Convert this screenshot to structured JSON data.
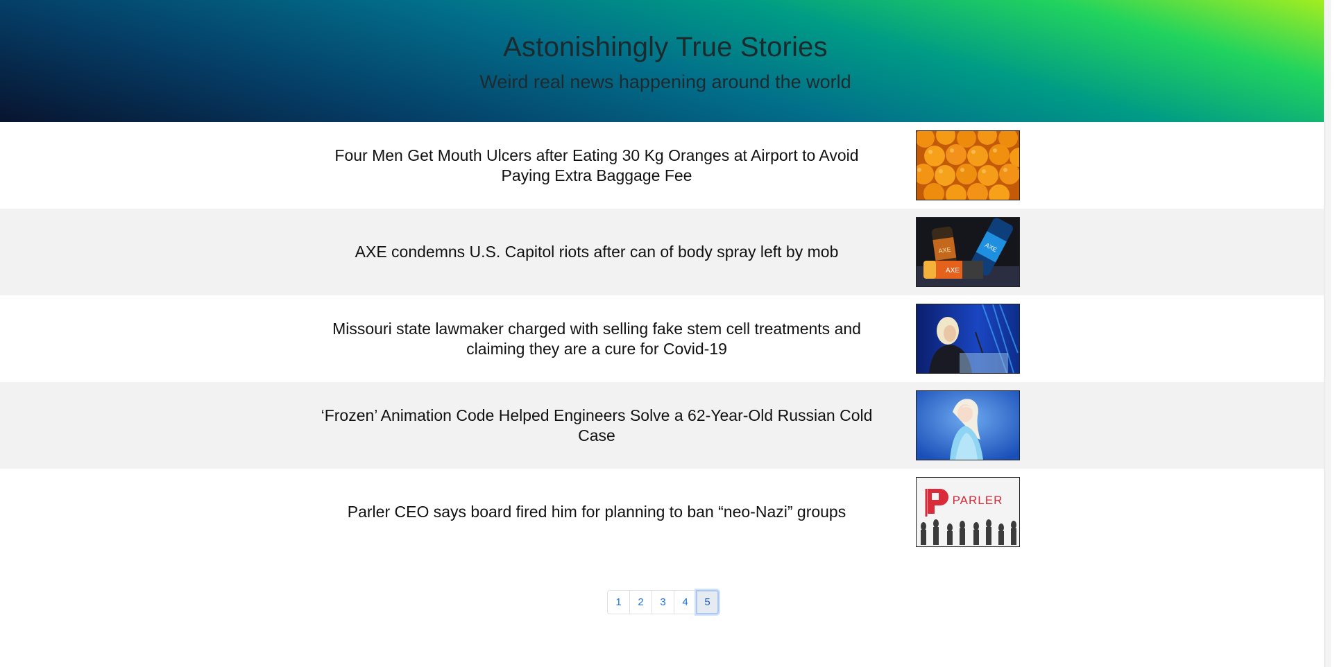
{
  "header": {
    "title": "Astonishingly True Stories",
    "subtitle": "Weird real news happening around the world"
  },
  "articles": [
    {
      "title": "Four Men Get Mouth Ulcers after Eating 30 Kg Oranges at Airport to Avoid Paying Extra Baggage Fee",
      "image": "oranges-image"
    },
    {
      "title": "AXE condemns U.S. Capitol riots after can of body spray left by mob",
      "image": "axe-spray-image",
      "image_text": "AXE"
    },
    {
      "title": "Missouri state lawmaker charged with selling fake stem cell treatments and claiming they are a cure for Covid-19",
      "image": "lawmaker-podium-image"
    },
    {
      "title": "‘Frozen’ Animation Code Helped Engineers Solve a 62-Year-Old Russian Cold Case",
      "image": "frozen-elsa-image"
    },
    {
      "title": "Parler CEO says board fired him for planning to ban “neo-Nazi” groups",
      "image": "parler-logo-image",
      "image_text": "PARLER"
    }
  ],
  "pagination": {
    "pages": [
      "1",
      "2",
      "3",
      "4",
      "5"
    ],
    "current": "5"
  },
  "colors": {
    "link": "#1a73e8",
    "row_shade": "#f2f2f2",
    "parler_red": "#d92b3a"
  }
}
